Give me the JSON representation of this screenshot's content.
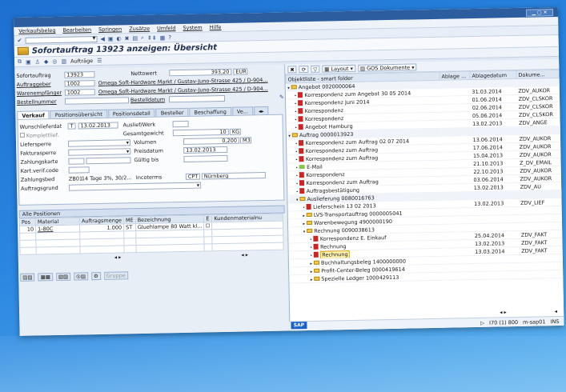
{
  "menu": [
    "Verkaufsbeleg",
    "Bearbeiten",
    "Springen",
    "Zusätze",
    "Umfeld",
    "System",
    "Hilfe"
  ],
  "title": "Sofortauftrag 13923 anzeigen: Übersicht",
  "toolbar2": {
    "auftraege": "Aufträge"
  },
  "header": {
    "sofortauftrag_label": "Sofortauftrag",
    "sofortauftrag": "13923",
    "nettowert_label": "Nettowert",
    "nettowert": "393,20",
    "currency": "EUR",
    "auftraggeber_label": "Auftraggeber",
    "auftraggeber": "1002",
    "auftraggeber_name": "Omega Soft-Hardware Markt / Gustav-Juno-Strasse 425 / D-904...",
    "warenempfaenger_label": "Warenempfänger",
    "warenempfaenger": "1002",
    "warenempfaenger_name": "Omega Soft-Hardware Markt / Gustav-Juno-Strasse 425 / D-904...",
    "bestellnummer_label": "Bestellnummer",
    "bestelldatum_label": "Bestelldatum"
  },
  "tabs": [
    "Verkauf",
    "Positionsübersicht",
    "Positionsdetail",
    "Besteller",
    "Beschaffung",
    "Ve..."
  ],
  "verkauf": {
    "wunschlieferdat_label": "Wunschlieferdat",
    "wunschlieferdat_t": "T",
    "wunschlieferdat": "13.02.2013",
    "auslief_label": "Auslief/Werk",
    "komplettlief_label": "Komplettlief.",
    "gesamtgewicht_label": "Gesamtgewicht",
    "gesamtgewicht": "10",
    "gesamtgewicht_unit": "KG",
    "liefersperre_label": "Liefersperre",
    "volumen_label": "Volumen",
    "volumen": "0,200",
    "volumen_unit": "M3",
    "fakturasperre_label": "Fakturasperre",
    "preisdatum_label": "Preisdatum",
    "preisdatum": "13.02.2013",
    "zahlungskarte_label": "Zahlungskarte",
    "gueltig_label": "Gültig bis",
    "kartverif_label": "Kart.verif.code",
    "zahlungsbed_label": "Zahlungsbed",
    "zahlungsbed": "ZB01",
    "zahlungsbed_text": "14 Tage 3%, 30/2...",
    "incoterms_label": "Incoterms",
    "incoterms": "CPT",
    "incoterms_text": "Nürnberg",
    "auftragsgrund_label": "Auftragsgrund"
  },
  "positions": {
    "section": "Alle Positionen",
    "columns": [
      "Pos",
      "Material",
      "Auftragsmenge",
      "ME",
      "Bezeichnung",
      "E",
      "Kundenmaterialnu"
    ],
    "rows": [
      {
        "pos": "10",
        "material": "1-80C",
        "menge": "1.000",
        "me": "ST",
        "bez": "Gluehlampe 80 Watt kl..."
      }
    ]
  },
  "bottom_buttons": {
    "gruppe": "Gruppe"
  },
  "right_toolbar": {
    "layout": "Layout",
    "gos": "GOS Dokumente"
  },
  "tree": {
    "columns": [
      "Objektliste - smart folder",
      "Ablage ...",
      "Ablagedatum",
      "Dokume..."
    ],
    "rows": [
      {
        "label": "Angebot 0020000064",
        "date": "",
        "doc": "",
        "type": "group",
        "indent": 0,
        "marker": "▾"
      },
      {
        "label": "Korrespondenz zum Angebot 30 05 2014",
        "date": "31.03.2014",
        "doc": "ZDV_AUKOR",
        "type": "doc",
        "indent": 1,
        "marker": ""
      },
      {
        "label": "Korrespondenz Juni 2014",
        "date": "01.06.2014",
        "doc": "ZDV_CLSKOR",
        "type": "doc",
        "indent": 1,
        "marker": ""
      },
      {
        "label": "Korrespondenz",
        "date": "02.06.2014",
        "doc": "ZDV_CLSKOR",
        "type": "doc",
        "indent": 1,
        "marker": ""
      },
      {
        "label": "Korrespondenz",
        "date": "05.06.2014",
        "doc": "ZDV_CLSKOR",
        "type": "doc",
        "indent": 1,
        "marker": ""
      },
      {
        "label": "Angebot Hamburg",
        "date": "13.02.2013",
        "doc": "ZDV_ANGE",
        "type": "doc",
        "indent": 1,
        "marker": ""
      },
      {
        "label": "Auftrag 0000013923",
        "date": "",
        "doc": "",
        "type": "group",
        "indent": 0,
        "marker": "▾"
      },
      {
        "label": "Korrespondenz zum Auftrag 02 07 2014",
        "date": "13.06.2014",
        "doc": "ZDV_AUKOR",
        "type": "doc",
        "indent": 1,
        "marker": ""
      },
      {
        "label": "Korrespondenz zum Auftrag",
        "date": "17.06.2014",
        "doc": "ZDV_AUKOR",
        "type": "doc",
        "indent": 1,
        "marker": ""
      },
      {
        "label": "Korrespondenz zum Auftrag",
        "date": "15.04.2013",
        "doc": "ZDV_AUKOR",
        "type": "doc",
        "indent": 1,
        "marker": ""
      },
      {
        "label": "E-Mail",
        "date": "21.10.2013",
        "doc": "Z_DV_EMAIL",
        "type": "mail",
        "indent": 1,
        "marker": ""
      },
      {
        "label": "Korrespondenz",
        "date": "22.10.2013",
        "doc": "ZDV_AUKOR",
        "type": "doc",
        "indent": 1,
        "marker": ""
      },
      {
        "label": "Korrespondenz zum Auftrag",
        "date": "03.06.2014",
        "doc": "ZDV_AUKOR",
        "type": "doc",
        "indent": 1,
        "marker": ""
      },
      {
        "label": "Auftragsbestätigung",
        "date": "13.02.2013",
        "doc": "ZDV_AU",
        "type": "doc",
        "indent": 1,
        "marker": ""
      },
      {
        "label": "Auslieferung 0080016763",
        "date": "",
        "doc": "",
        "type": "group",
        "indent": 1,
        "marker": "▾"
      },
      {
        "label": "Lieferschein 13 02 2013",
        "date": "13.02.2013",
        "doc": "ZDV_LIEF",
        "type": "doc",
        "indent": 2,
        "marker": ""
      },
      {
        "label": "LVS-Transportauftrag 0000005041",
        "date": "",
        "doc": "",
        "type": "folder",
        "indent": 2,
        "marker": "▸"
      },
      {
        "label": "Warenbewegung 4900000190",
        "date": "",
        "doc": "",
        "type": "folder",
        "indent": 2,
        "marker": "▸"
      },
      {
        "label": "Rechnung 0090038613",
        "date": "",
        "doc": "",
        "type": "folder",
        "indent": 2,
        "marker": "▾"
      },
      {
        "label": "Korrespondenz E. Einkauf",
        "date": "25.04.2014",
        "doc": "ZDV_FAKT",
        "type": "doc",
        "indent": 3,
        "marker": ""
      },
      {
        "label": "Rechnung",
        "date": "13.02.2013",
        "doc": "ZDV_FAKT",
        "type": "doc",
        "indent": 3,
        "marker": ""
      },
      {
        "label": "Rechnung",
        "date": "13.03.2014",
        "doc": "ZDV_FAKT",
        "type": "highlight",
        "indent": 3,
        "marker": ""
      },
      {
        "label": "Buchhaltungsbeleg 1400000000",
        "date": "",
        "doc": "",
        "type": "folder",
        "indent": 3,
        "marker": "▸"
      },
      {
        "label": "Profit-Center-Beleg 0000419614",
        "date": "",
        "doc": "",
        "type": "folder",
        "indent": 3,
        "marker": "▸"
      },
      {
        "label": "Spezielle Ledger 1000429113",
        "date": "",
        "doc": "",
        "type": "folder",
        "indent": 3,
        "marker": "▸"
      }
    ]
  },
  "status": {
    "session": "I70 (1) 800",
    "server": "m-sap01",
    "mode": "INS"
  },
  "logo": "SAP"
}
